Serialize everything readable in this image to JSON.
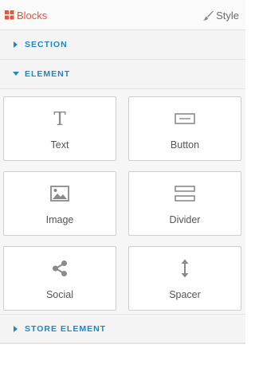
{
  "tabs": {
    "blocks": {
      "label": "Blocks",
      "icon": "grid-icon",
      "color": "#e8543c",
      "active": true
    },
    "style": {
      "label": "Style",
      "icon": "paintbrush-icon"
    }
  },
  "sections": [
    {
      "label": "SECTION",
      "expanded": false
    },
    {
      "label": "ELEMENT",
      "expanded": true
    },
    {
      "label": "STORE ELEMENT",
      "expanded": false
    }
  ],
  "element_blocks": [
    {
      "label": "Text",
      "icon": "text-icon"
    },
    {
      "label": "Button",
      "icon": "button-icon"
    },
    {
      "label": "Image",
      "icon": "image-icon"
    },
    {
      "label": "Divider",
      "icon": "divider-icon"
    },
    {
      "label": "Social",
      "icon": "share-icon"
    },
    {
      "label": "Spacer",
      "icon": "spacer-icon"
    }
  ],
  "colors": {
    "accent": "#e8543c",
    "section_label": "#1f86c6",
    "icon": "#8a8a8a"
  }
}
